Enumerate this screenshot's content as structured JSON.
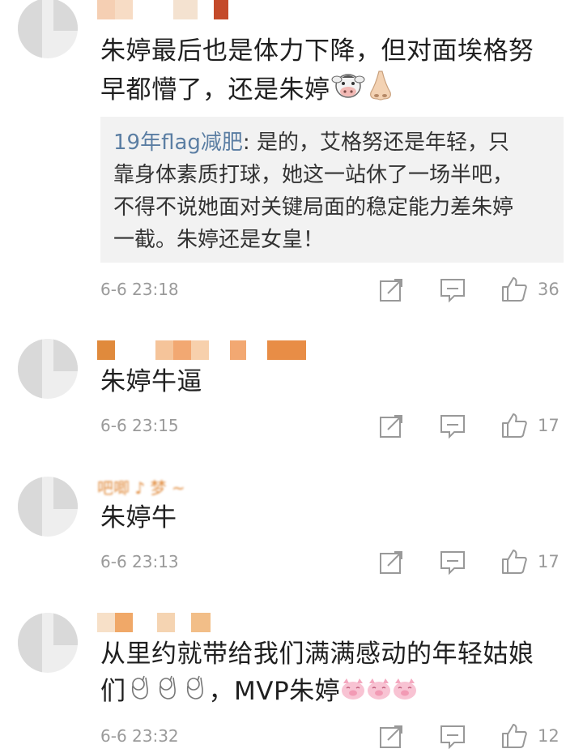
{
  "comments": [
    {
      "text_lines": [
        "朱婷最后也是体力下降，但对面埃格努",
        "早都懵了，还是朱婷"
      ],
      "quote": {
        "name": "19年flag减肥",
        "line1": "是的，艾格努还是年轻，只",
        "line2": "靠身体素质打球，她这一站休了一场半吧，",
        "line3": "不得不说她面对关键局面的稳定能力差朱婷",
        "line4": "一截。朱婷还是女皇！"
      },
      "time": "6-6 23:18",
      "likes": "36"
    },
    {
      "username": "",
      "text_lines": [
        "朱婷牛逼"
      ],
      "time": "6-6 23:15",
      "likes": "17"
    },
    {
      "username": "吧唧 ♪ 梦 ~",
      "text_lines": [
        "朱婷牛"
      ],
      "time": "6-6 23:13",
      "likes": "17"
    },
    {
      "text_lines": [
        "从里约就带给我们满满感动的年轻姑娘",
        "们",
        "，MVP朱婷"
      ],
      "time": "6-6 23:32",
      "likes": "12"
    }
  ],
  "icons": {
    "repost": "repost-icon",
    "comment": "comment-icon",
    "like": "thumbs-up-icon",
    "emoji_cow": "cow-face-emoji-icon",
    "emoji_nose": "nose-emoji-icon",
    "emoji_ok": "ok-hand-emoji-icon",
    "emoji_pig": "pig-face-emoji-icon"
  },
  "colors": {
    "quote_name": "#5b7ea3",
    "meta": "#9a9a9a",
    "quote_bg": "#f2f2f2"
  }
}
